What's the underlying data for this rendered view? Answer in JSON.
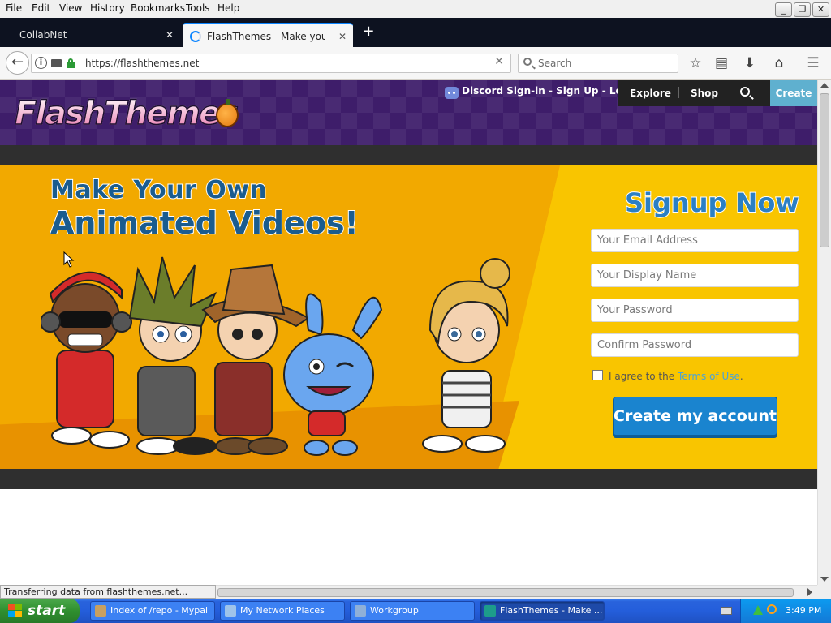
{
  "menubar": {
    "items": [
      "File",
      "Edit",
      "View",
      "History",
      "Bookmarks",
      "Tools",
      "Help"
    ],
    "window_buttons": {
      "minimize": "_",
      "restore": "❐",
      "close": "✕"
    }
  },
  "tabs": [
    {
      "title": "CollabNet",
      "state": "inactive"
    },
    {
      "title": "FlashThemes - Make your own",
      "state": "active-loading"
    }
  ],
  "newtab_label": "+",
  "navbar": {
    "url": "https://flashthemes.net",
    "search_placeholder": "Search",
    "icons": [
      "back-icon",
      "info-icon",
      "permissions-icon",
      "lock-icon",
      "clear-icon",
      "search-icon",
      "bookmark-star-icon",
      "reading-list-icon",
      "downloads-icon",
      "home-icon",
      "menu-icon"
    ]
  },
  "site": {
    "logo": "FlashThemes",
    "nav": {
      "discord": "Discord Sign-in - Sign Up - Login",
      "explore": "Explore",
      "shop": "Shop",
      "create": "Create"
    },
    "hero": {
      "headline_1": "Make Your Own",
      "headline_2": "Animated Videos!"
    },
    "signup": {
      "title": "Signup Now",
      "email_placeholder": "Your Email Address",
      "display_name_placeholder": "Your Display Name",
      "password_placeholder": "Your Password",
      "confirm_placeholder": "Confirm Password",
      "terms_prefix": "I agree to the ",
      "terms_link": "Terms of Use",
      "terms_suffix": ".",
      "button": "Create my account"
    }
  },
  "statusbar": {
    "text": "Transferring data from flashthemes.net..."
  },
  "taskbar": {
    "start_label": "start",
    "tasks": [
      {
        "label": "Index of /repo - Mypal",
        "active": false
      },
      {
        "label": "My Network Places",
        "active": false
      },
      {
        "label": "Workgroup",
        "active": false
      },
      {
        "label": "FlashThemes - Make ...",
        "active": true
      }
    ],
    "clock": "3:49 PM"
  },
  "colors": {
    "firefox_accent": "#0a84ff",
    "site_purple": "#3e1d6a",
    "hero_yellow": "#f9c500",
    "create_button": "#1a84cf",
    "nav_create": "#5fb0cf",
    "xp_blue": "#245edb",
    "xp_start_green": "#2f8f2f"
  }
}
